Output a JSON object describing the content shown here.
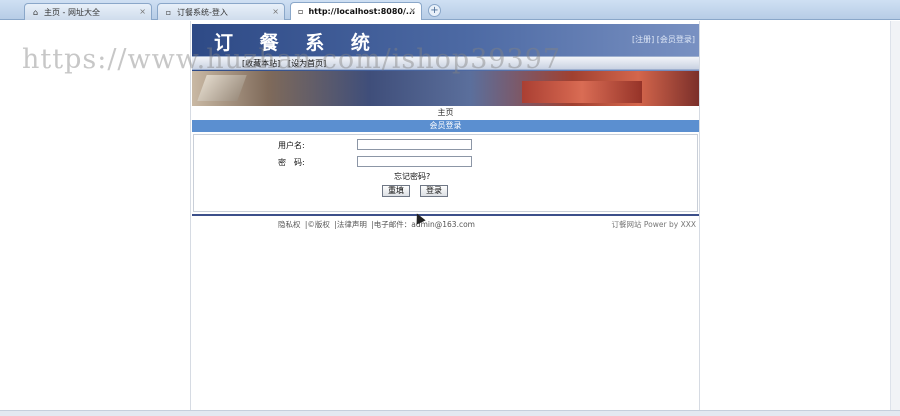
{
  "browser": {
    "tabs": [
      {
        "label": "主页 - 网址大全",
        "icon": "home-icon",
        "active": false
      },
      {
        "label": "订餐系统-登入",
        "icon": "page-icon",
        "active": false
      },
      {
        "label": "http://localhost:8080/...",
        "icon": "page-icon",
        "active": true
      }
    ],
    "close_glyph": "×",
    "newtab_glyph": "+"
  },
  "watermark": "https://www.huzhan.com/ishop39397",
  "header": {
    "title": "订 餐 系 统",
    "toplinks": "[注册] [会员登录]",
    "nav_items": [
      "[收藏本站]",
      "[设为首页]"
    ]
  },
  "home_link": "主页",
  "section_title": "会员登录",
  "login": {
    "username_label": "用户名:",
    "password_label": "密　码:",
    "username_value": "",
    "password_value": "",
    "forgot_label": "忘记密码?",
    "reset_label": "重填",
    "login_label": "登录"
  },
  "footer": {
    "links": [
      "隐私权",
      "|©版权",
      "|法律声明",
      "|电子邮件：admin@163.com"
    ],
    "right": "订餐网站   Power by XXX"
  },
  "colors": {
    "banner": "#3a5690",
    "section_bar": "#5b8fd0",
    "footer_line": "#3c4f8a"
  }
}
